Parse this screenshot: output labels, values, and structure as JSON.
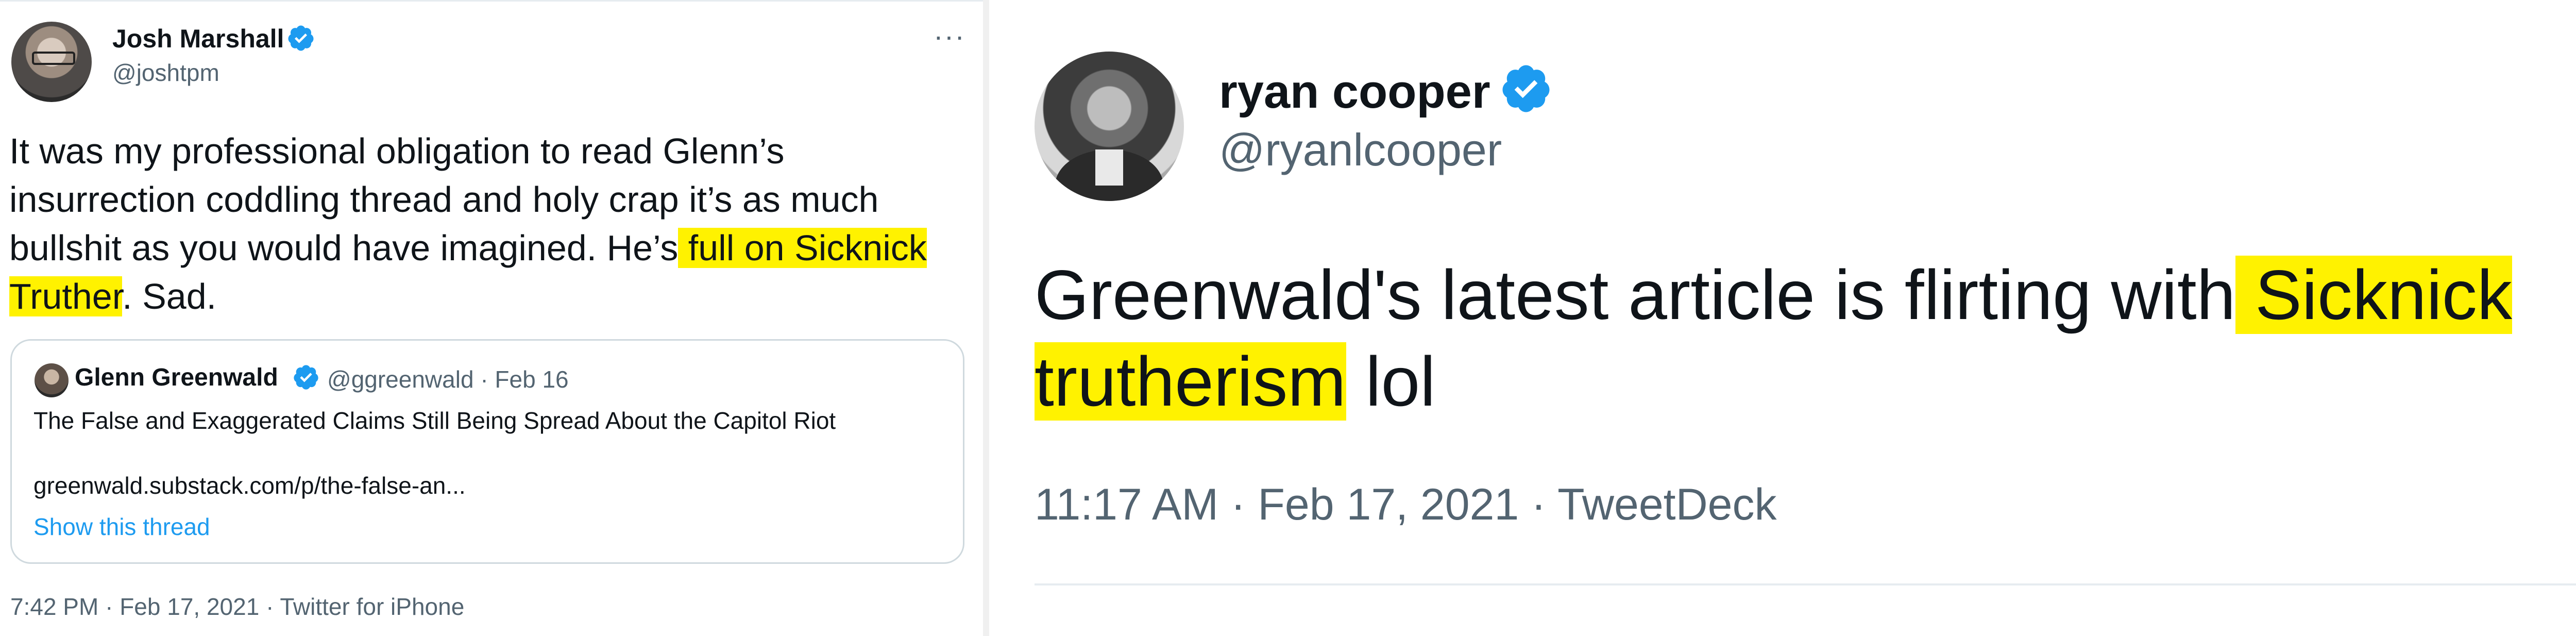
{
  "left_tweet": {
    "author": {
      "name": "Josh Marshall",
      "handle": "@joshtpm",
      "verified": true
    },
    "more_label": "···",
    "body": {
      "part1": "It was my professional obligation to read Glenn’s insurrection coddling thread and holy crap it’s as much bullshit as you would have imagined. He’s",
      "highlight": " full on Sicknick Truther",
      "part2": ". Sad."
    },
    "quoted": {
      "name": "Glenn Greenwald",
      "handle_date": "@ggreenwald · Feb 16",
      "title": "The False and Exaggerated Claims Still Being Spread About the Capitol Riot",
      "url": "greenwald.substack.com/p/the-false-an...",
      "show_thread": "Show this thread"
    },
    "timestamp": "7:42 PM · Feb 17, 2021 · Twitter for iPhone"
  },
  "right_tweet": {
    "author": {
      "name": "ryan cooper",
      "handle": "@ryanlcooper",
      "verified": true
    },
    "body": {
      "part1": "Greenwald's latest article is flirting with",
      "highlight": " Sicknick trutherism",
      "part2": " lol"
    },
    "timestamp": "11:17 AM · Feb 17, 2021 · TweetDeck"
  },
  "colors": {
    "verified": "#1d9bf0",
    "highlight": "#fff200",
    "link": "#1d9bf0",
    "secondary_text": "#536471"
  },
  "icons": {
    "verified": "verified-badge-icon",
    "more": "more-dots-icon"
  }
}
